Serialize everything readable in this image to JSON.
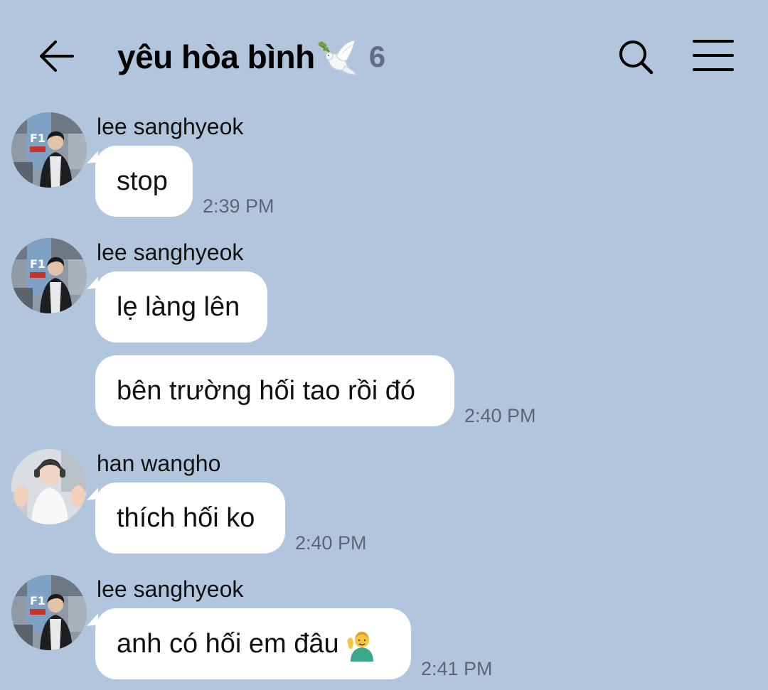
{
  "header": {
    "title": "yêu hòa bình",
    "title_emoji": "dove-icon",
    "member_count": "6",
    "back_icon": "back-arrow-icon",
    "search_icon": "search-icon",
    "menu_icon": "menu-icon"
  },
  "colors": {
    "background": "#b1c6dc",
    "bubble": "#ffffff",
    "time_text": "#5b6776",
    "member_count": "#5f6e80"
  },
  "messages": [
    {
      "sender": "lee sanghyeok",
      "avatar": "avatar-lee-sanghyeok",
      "bubbles": [
        "stop"
      ],
      "time": "2:39 PM"
    },
    {
      "sender": "lee sanghyeok",
      "avatar": "avatar-lee-sanghyeok",
      "bubbles": [
        "lẹ làng lên",
        "bên trường hối tao rồi đó"
      ],
      "time": "2:40 PM"
    },
    {
      "sender": "han wangho",
      "avatar": "avatar-han-wangho",
      "bubbles": [
        "thích hối ko"
      ],
      "time": "2:40 PM"
    },
    {
      "sender": "lee sanghyeok",
      "avatar": "avatar-lee-sanghyeok",
      "bubbles": [
        "anh có hối em đâu"
      ],
      "bubble_emoji": "person-tipping-hand-icon",
      "time": "2:41 PM"
    }
  ]
}
